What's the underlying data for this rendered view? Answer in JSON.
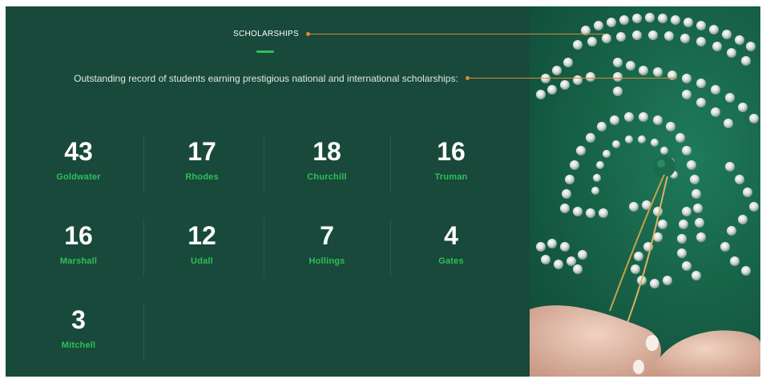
{
  "section": {
    "label": "SCHOLARSHIPS",
    "intro": "Outstanding record of students earning prestigious national and international scholarships:"
  },
  "stats": [
    {
      "value": "43",
      "name": "Goldwater"
    },
    {
      "value": "17",
      "name": "Rhodes"
    },
    {
      "value": "18",
      "name": "Churchill"
    },
    {
      "value": "16",
      "name": "Truman"
    },
    {
      "value": "16",
      "name": "Marshall"
    },
    {
      "value": "12",
      "name": "Udall"
    },
    {
      "value": "7",
      "name": "Hollings"
    },
    {
      "value": "4",
      "name": "Gates"
    },
    {
      "value": "3",
      "name": "Mitchell"
    }
  ],
  "colors": {
    "background": "#18493a",
    "accent": "#2fbf59",
    "callout": "#e08a2c",
    "text": "#ffffff"
  },
  "photo": {
    "subject": "green-robe-with-rhinestone-spartan-emblem"
  }
}
